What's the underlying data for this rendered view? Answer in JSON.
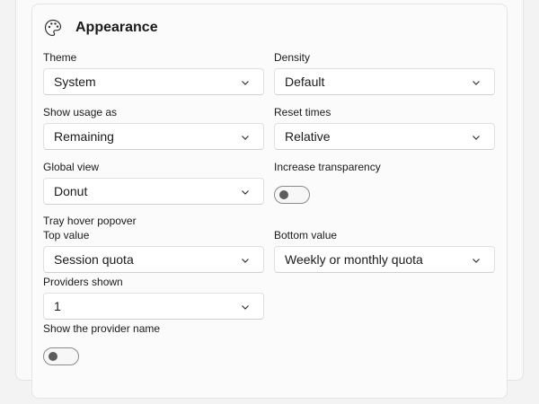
{
  "section": {
    "title": "Appearance",
    "icon": "palette-icon"
  },
  "theme": {
    "label": "Theme",
    "value": "System"
  },
  "density": {
    "label": "Density",
    "value": "Default"
  },
  "show_usage": {
    "label": "Show usage as",
    "value": "Remaining"
  },
  "reset_times": {
    "label": "Reset times",
    "value": "Relative"
  },
  "global_view": {
    "label": "Global view",
    "value": "Donut"
  },
  "increase_transparency": {
    "label": "Increase transparency",
    "on": false
  },
  "tray_popover": {
    "heading": "Tray hover popover",
    "top_value": {
      "label": "Top value",
      "value": "Session quota"
    },
    "bottom_value": {
      "label": "Bottom value",
      "value": "Weekly or monthly quota"
    },
    "providers_shown": {
      "label": "Providers shown",
      "value": "1"
    },
    "show_provider_name": {
      "label": "Show the provider name",
      "on": false
    }
  },
  "colors": {
    "background": "#f3f3f3",
    "card": "#fbfbfb",
    "border": "#e5e5e5",
    "toggle_knob": "#5c5c5c"
  }
}
